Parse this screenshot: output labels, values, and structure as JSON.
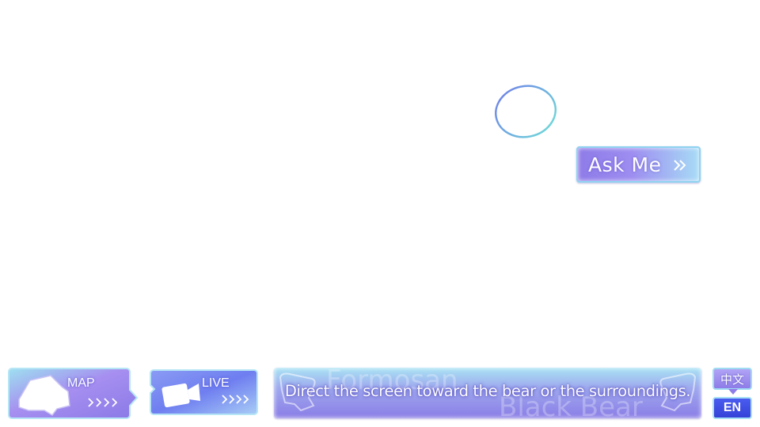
{
  "scan_target": {
    "icon": "target-ring-icon"
  },
  "ask_button": {
    "label": "Ask Me",
    "icon": "double-chevron-right-icon"
  },
  "bottom_bar": {
    "map_button": {
      "label": "MAP",
      "icon": "map-icon"
    },
    "live_button": {
      "label": "LIVE",
      "icon": "camera-icon"
    },
    "caption": {
      "text": "Direct the screen toward the bear or the surroundings.",
      "background_words": [
        "Formosan",
        "Black Bear"
      ]
    },
    "language": {
      "zh_label": "中文",
      "en_label": "EN",
      "selected": "EN"
    }
  },
  "colors": {
    "accent_purple": "#8e7be8",
    "accent_cyan": "#a7dbf6",
    "en_blue": "#3442d8"
  }
}
